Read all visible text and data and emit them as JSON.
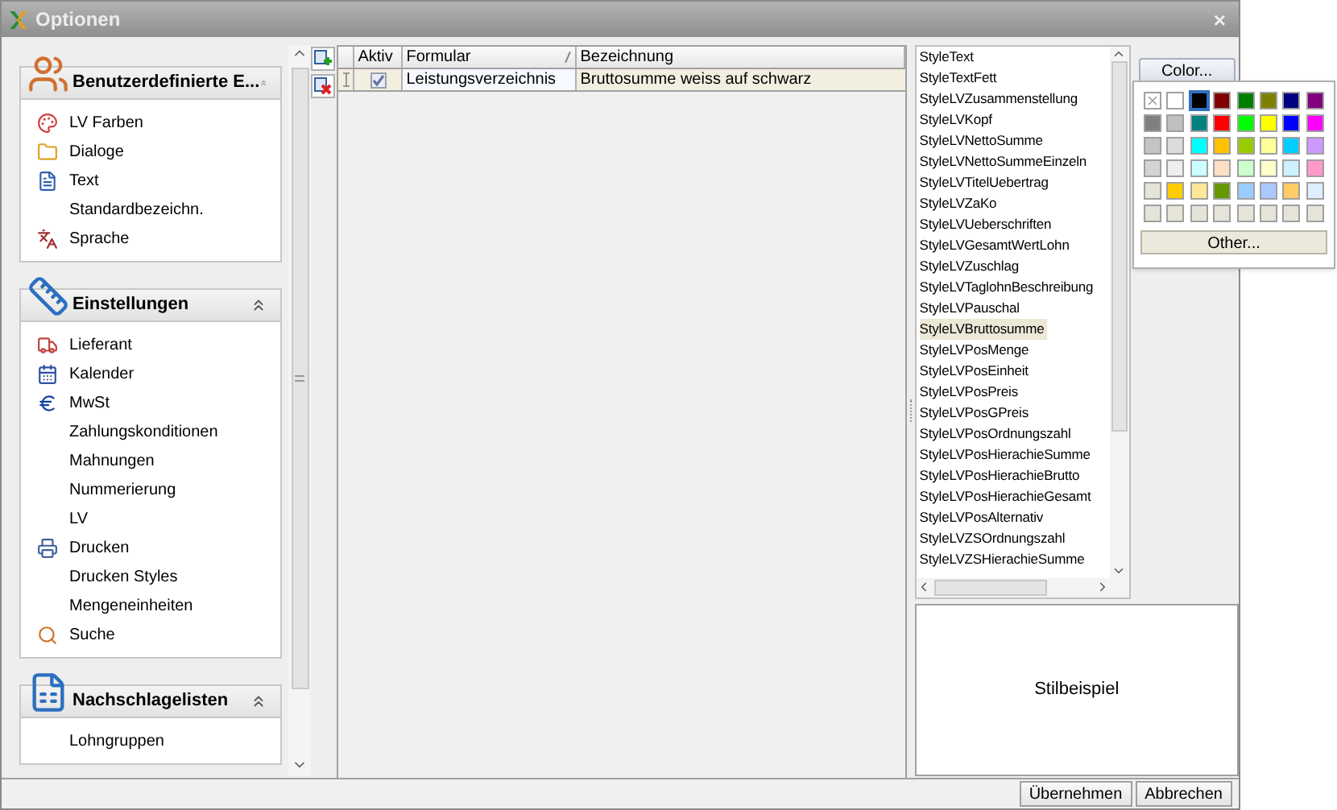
{
  "window": {
    "title": "Optionen",
    "close": "×"
  },
  "nav_groups": [
    {
      "title": "Benutzerdefinierte E...",
      "expanded": true,
      "items": [
        {
          "label": "LV Farben"
        },
        {
          "label": "Dialoge"
        },
        {
          "label": "Text"
        },
        {
          "label": "Standardbezeichn."
        },
        {
          "label": "Sprache"
        }
      ]
    },
    {
      "title": "Einstellungen",
      "expanded": true,
      "items": [
        {
          "label": "Lieferant"
        },
        {
          "label": "Kalender"
        },
        {
          "label": "MwSt"
        },
        {
          "label": "Zahlungskonditionen"
        },
        {
          "label": "Mahnungen"
        },
        {
          "label": "Nummerierung"
        },
        {
          "label": "LV"
        },
        {
          "label": "Drucken"
        },
        {
          "label": "Drucken Styles"
        },
        {
          "label": "Mengeneinheiten"
        },
        {
          "label": "Suche"
        }
      ]
    },
    {
      "title": "Nachschlagelisten",
      "expanded": true,
      "items": [
        {
          "label": "Lohngruppen"
        }
      ]
    }
  ],
  "grid": {
    "columns": [
      "Aktiv",
      "Formular",
      "Bezeichnung"
    ],
    "rows": [
      {
        "aktiv": true,
        "formular": "Leistungsverzeichnis",
        "bezeichnung": "Bruttosumme weiss auf schwarz",
        "selected": true
      }
    ]
  },
  "styles": [
    {
      "label": "StyleText",
      "selected": false
    },
    {
      "label": "StyleTextFett",
      "selected": false
    },
    {
      "label": "StyleLVZusammenstellung",
      "selected": false
    },
    {
      "label": "StyleLVKopf",
      "selected": false
    },
    {
      "label": "StyleLVNettoSumme",
      "selected": false
    },
    {
      "label": "StyleLVNettoSummeEinzeln",
      "selected": false
    },
    {
      "label": "StyleLVTitelUebertrag",
      "selected": false
    },
    {
      "label": "StyleLVZaKo",
      "selected": false
    },
    {
      "label": "StyleLVUeberschriften",
      "selected": false
    },
    {
      "label": "StyleLVGesamtWertLohn",
      "selected": false
    },
    {
      "label": "StyleLVZuschlag",
      "selected": false
    },
    {
      "label": "StyleLVTaglohnBeschreibung",
      "selected": false
    },
    {
      "label": "StyleLVPauschal",
      "selected": false
    },
    {
      "label": "StyleLVBruttosumme",
      "selected": true
    },
    {
      "label": "StyleLVPosMenge",
      "selected": false
    },
    {
      "label": "StyleLVPosEinheit",
      "selected": false
    },
    {
      "label": "StyleLVPosPreis",
      "selected": false
    },
    {
      "label": "StyleLVPosGPreis",
      "selected": false
    },
    {
      "label": "StyleLVPosOrdnungszahl",
      "selected": false
    },
    {
      "label": "StyleLVPosHierachieSumme",
      "selected": false
    },
    {
      "label": "StyleLVPosHierachieBrutto",
      "selected": false
    },
    {
      "label": "StyleLVPosHierachieGesamt",
      "selected": false
    },
    {
      "label": "StyleLVPosAlternativ",
      "selected": false
    },
    {
      "label": "StyleLVZSOrdnungszahl",
      "selected": false
    },
    {
      "label": "StyleLVZSHierachieSumme",
      "selected": false
    }
  ],
  "preview": "Stilbeispiel",
  "color_button": "Color...",
  "palette": {
    "swatches": [
      {
        "kind": "none",
        "selected": false
      },
      {
        "color": "#ffffff",
        "selected": false
      },
      {
        "color": "#000000",
        "selected": true
      },
      {
        "color": "#800000",
        "selected": false
      },
      {
        "color": "#008000",
        "selected": false
      },
      {
        "color": "#808000",
        "selected": false
      },
      {
        "color": "#000080",
        "selected": false
      },
      {
        "color": "#800080",
        "selected": false
      },
      {
        "color": "#808080",
        "selected": false
      },
      {
        "color": "#c0c0c0",
        "selected": false
      },
      {
        "color": "#008080",
        "selected": false
      },
      {
        "color": "#ff0000",
        "selected": false
      },
      {
        "color": "#00ff00",
        "selected": false
      },
      {
        "color": "#ffff00",
        "selected": false
      },
      {
        "color": "#0000ff",
        "selected": false
      },
      {
        "color": "#ff00ff",
        "selected": false
      },
      {
        "color": "#c4c4c4",
        "selected": false
      },
      {
        "color": "#dcdcdc",
        "selected": false
      },
      {
        "color": "#00ffff",
        "selected": false
      },
      {
        "color": "#ffc000",
        "selected": false
      },
      {
        "color": "#99cc00",
        "selected": false
      },
      {
        "color": "#ffff99",
        "selected": false
      },
      {
        "color": "#00ccff",
        "selected": false
      },
      {
        "color": "#cc99ff",
        "selected": false
      },
      {
        "color": "#d4d4d4",
        "selected": false
      },
      {
        "color": "#eeeeee",
        "selected": false
      },
      {
        "color": "#ccffff",
        "selected": false
      },
      {
        "color": "#ffdfc4",
        "selected": false
      },
      {
        "color": "#ccffcc",
        "selected": false
      },
      {
        "color": "#ffffcc",
        "selected": false
      },
      {
        "color": "#ccf2ff",
        "selected": false
      },
      {
        "color": "#ff99cc",
        "selected": false
      },
      {
        "color": "#e6e4d8",
        "selected": false
      },
      {
        "color": "#ffcc00",
        "selected": false
      },
      {
        "color": "#ffe699",
        "selected": false
      },
      {
        "color": "#669900",
        "selected": false
      },
      {
        "color": "#99ccff",
        "selected": false
      },
      {
        "color": "#aac8ff",
        "selected": false
      },
      {
        "color": "#ffcc66",
        "selected": false
      },
      {
        "color": "#ddeeff",
        "selected": false
      },
      {
        "color": "#e6e4d8",
        "selected": false
      },
      {
        "color": "#e6e4d8",
        "selected": false
      },
      {
        "color": "#e6e4d8",
        "selected": false
      },
      {
        "color": "#e6e4d8",
        "selected": false
      },
      {
        "color": "#e6e4d8",
        "selected": false
      },
      {
        "color": "#e6e4d8",
        "selected": false
      },
      {
        "color": "#e6e4d8",
        "selected": false
      },
      {
        "color": "#e6e4d8",
        "selected": false
      }
    ],
    "other": "Other..."
  },
  "buttons": [
    "Übernehmen",
    "Abbrechen"
  ]
}
